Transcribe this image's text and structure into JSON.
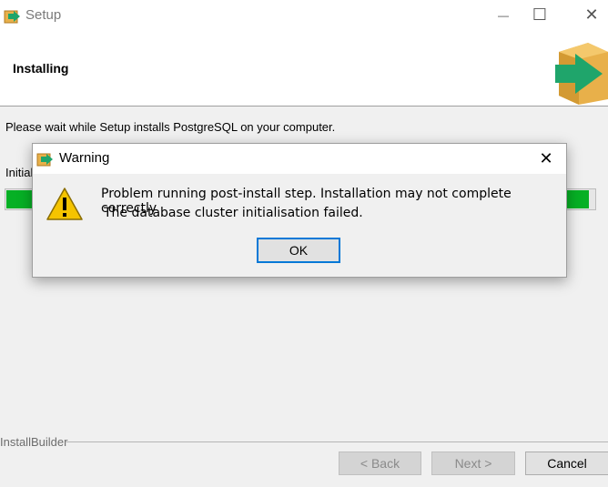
{
  "window": {
    "title": "Setup",
    "controls": {
      "minimize": "—",
      "maximize": "☐",
      "close": "✕"
    }
  },
  "header": {
    "heading": "Installing"
  },
  "main": {
    "description": "Please wait while Setup installs PostgreSQL on your computer.",
    "status_label": "Initial",
    "progress": 0.99,
    "progress_color": "#06b025"
  },
  "footer": {
    "brand": "InstallBuilder",
    "back_label": "< Back",
    "next_label": "Next >",
    "cancel_label": "Cancel"
  },
  "dialog": {
    "title": "Warning",
    "close": "✕",
    "message_line1": "Problem running post-install step. Installation may not complete correctly",
    "message_line2": "The database cluster initialisation failed.",
    "ok_label": "OK",
    "icon": "warning-icon"
  },
  "colors": {
    "accent": "#0078d7",
    "warning": "#f5c400",
    "logo_arrow": "#1fa56b",
    "logo_box": "#e8b04a"
  }
}
